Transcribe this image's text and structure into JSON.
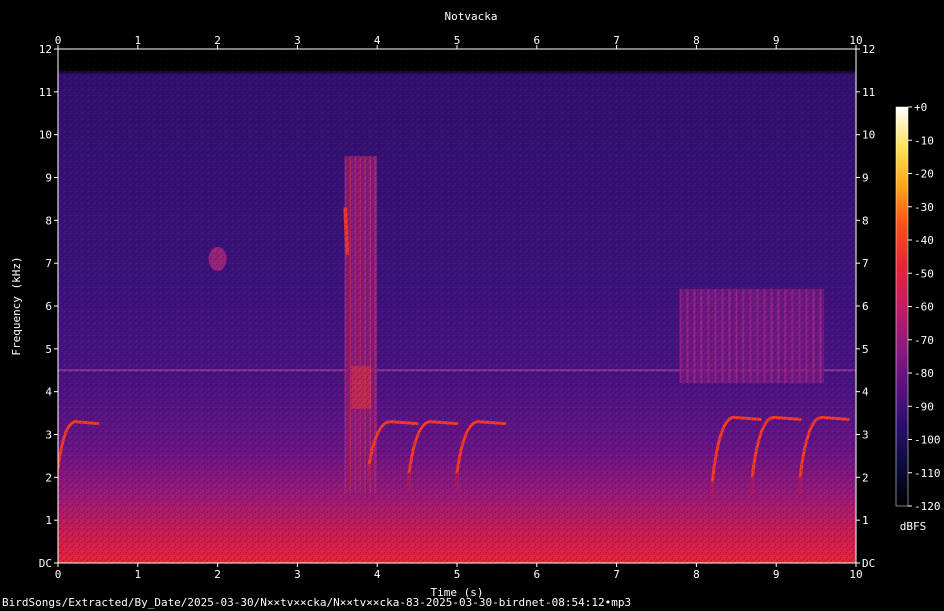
{
  "chart_data": {
    "type": "heatmap",
    "title": "Notvacka",
    "xlabel": "Time (s)",
    "ylabel": "Frequency (kHz)",
    "xlim": [
      0,
      10
    ],
    "ylim": [
      0,
      12
    ],
    "x_ticks": [
      "0",
      "1",
      "2",
      "3",
      "4",
      "5",
      "6",
      "7",
      "8",
      "9",
      "10"
    ],
    "y_ticks": [
      "DC",
      "1",
      "2",
      "3",
      "4",
      "5",
      "6",
      "7",
      "8",
      "9",
      "10",
      "11",
      "12"
    ],
    "colorbar": {
      "label": "dBFS",
      "ticks": [
        "+0",
        "-10",
        "-20",
        "-30",
        "-40",
        "-50",
        "-60",
        "-70",
        "-80",
        "-90",
        "-100",
        "-110",
        "-120"
      ],
      "range": [
        -120,
        0
      ],
      "colors": [
        "#000000",
        "#0b0c3a",
        "#2a0e6b",
        "#5a1181",
        "#8c1a7e",
        "#c21c62",
        "#e8233a",
        "#f64d18",
        "#fba41a",
        "#fde35c",
        "#ffffff"
      ]
    },
    "noise_ceiling_khz": 11.6,
    "horizontal_line_khz": 4.5,
    "features": [
      {
        "kind": "call-arc",
        "t": 0.0,
        "f_low": 2.4,
        "f_high": 3.3,
        "duration": 0.5
      },
      {
        "kind": "broadband-burst",
        "t_start": 3.6,
        "t_end": 4.0,
        "f_low": 1.6,
        "f_high": 9.5
      },
      {
        "kind": "call-arc",
        "t": 3.9,
        "f_low": 2.5,
        "f_high": 3.3,
        "duration": 0.6
      },
      {
        "kind": "call-arc",
        "t": 4.4,
        "f_low": 2.3,
        "f_high": 3.3,
        "duration": 0.6
      },
      {
        "kind": "call-arc",
        "t": 5.0,
        "f_low": 2.3,
        "f_high": 3.3,
        "duration": 0.6
      },
      {
        "kind": "call-arc",
        "t": 8.2,
        "f_low": 2.1,
        "f_high": 3.4,
        "duration": 0.6
      },
      {
        "kind": "call-arc",
        "t": 8.7,
        "f_low": 2.2,
        "f_high": 3.4,
        "duration": 0.6
      },
      {
        "kind": "call-arc",
        "t": 9.3,
        "f_low": 2.2,
        "f_high": 3.4,
        "duration": 0.6
      },
      {
        "kind": "trill-block",
        "t_start": 7.8,
        "t_end": 9.6,
        "f_low": 4.2,
        "f_high": 6.4
      },
      {
        "kind": "blob",
        "t": 2.0,
        "f": 7.1
      },
      {
        "kind": "streak",
        "t": 3.6,
        "f_low": 7.2,
        "f_high": 8.3
      }
    ]
  },
  "footer": {
    "path": "BirdSongs/Extracted/By_Date/2025-03-30/N××tv××cka/N××tv××cka-83-2025-03-30-birdnet-08:54:12•mp3"
  }
}
